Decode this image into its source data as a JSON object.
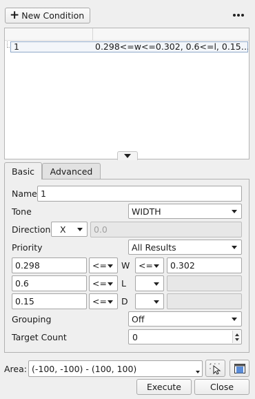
{
  "toolbar": {
    "new_condition_label": "New Condition",
    "more_icon_text": "•••"
  },
  "conditions_list": {
    "rows": [
      {
        "name": "1",
        "summary": "0.298<=w<=0.302, 0.6<=l, 0.15…"
      }
    ]
  },
  "tabs": {
    "basic": "Basic",
    "advanced": "Advanced"
  },
  "form": {
    "name_label": "Name",
    "name_value": "1",
    "tone_label": "Tone",
    "tone_value": "WIDTH",
    "direction_label": "Direction",
    "direction_value": "X",
    "direction_input_value": "0.0",
    "priority_label": "Priority",
    "priority_value": "All Results",
    "ranges": [
      {
        "min": "0.298",
        "min_op": "<=",
        "var": "W",
        "max_op": "<=",
        "max": "0.302"
      },
      {
        "min": "0.6",
        "min_op": "<=",
        "var": "L",
        "max_op": "",
        "max": ""
      },
      {
        "min": "0.15",
        "min_op": "<=",
        "var": "D",
        "max_op": "",
        "max": ""
      }
    ],
    "grouping_label": "Grouping",
    "grouping_value": "Off",
    "target_count_label": "Target Count",
    "target_count_value": "0"
  },
  "area": {
    "label": "Area:",
    "value": "(-100, -100) - (100, 100)"
  },
  "footer": {
    "execute_label": "Execute",
    "close_label": "Close"
  },
  "colors": {
    "selection_border": "#8fa8c8",
    "background": "#efefef"
  }
}
